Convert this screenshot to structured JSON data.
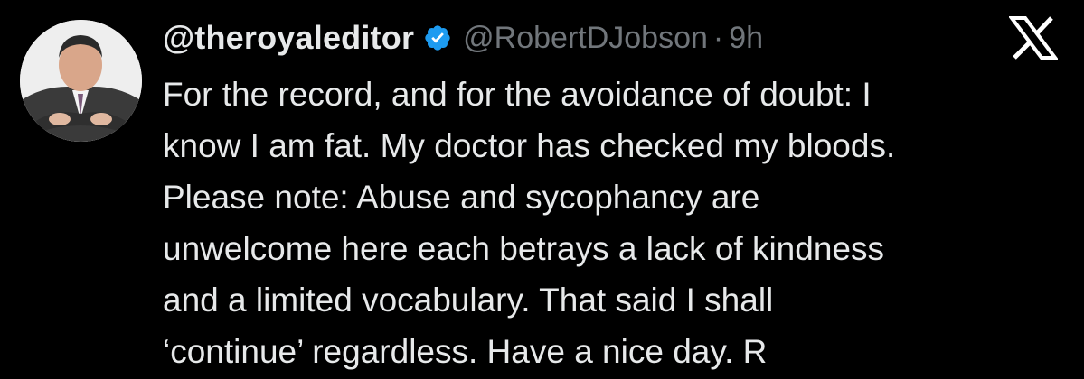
{
  "tweet": {
    "display_name": "@theroyaleditor",
    "handle": "@RobertDJobson",
    "separator": "·",
    "time": "9h",
    "lines": [
      "For the record, and for the avoidance of doubt: I",
      "know I am fat. My doctor has checked my bloods.",
      "Please note: Abuse and sycophancy are",
      "unwelcome here each betrays a lack of kindness",
      "and a limited vocabulary. That said I shall",
      "‘continue’ regardless. Have a nice day. R"
    ]
  },
  "icons": {
    "verified": "verified-badge-icon",
    "logo": "x-logo-icon",
    "avatar": "profile-photo"
  },
  "colors": {
    "background": "#000000",
    "text": "#e7e9ea",
    "secondary": "#71767b",
    "verified": "#1d9bf0"
  }
}
